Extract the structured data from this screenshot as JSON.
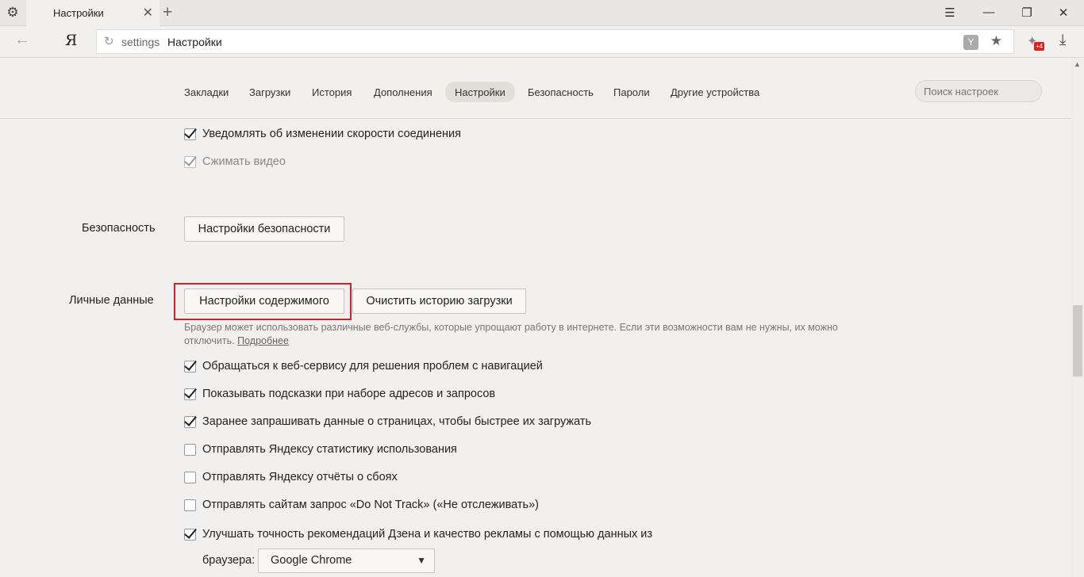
{
  "browser": {
    "tab_title": "Настройки",
    "tab_close": "✕",
    "new_tab": "+",
    "win_menu": "☰",
    "win_minimize": "—",
    "win_restore": "❐",
    "win_close": "✕",
    "logo": "Я",
    "url_prefix": "settings",
    "url_title": "Настройки",
    "notification_badge": "+4"
  },
  "settings_nav": {
    "items": [
      "Закладки",
      "Загрузки",
      "История",
      "Дополнения",
      "Настройки",
      "Безопасность",
      "Пароли",
      "Другие устройства"
    ],
    "active": "Настройки",
    "search_placeholder": "Поиск настроек"
  },
  "top_checks": [
    {
      "label": "Уведомлять об изменении скорости соединения",
      "checked": true,
      "disabled": false
    },
    {
      "label": "Сжимать видео",
      "checked": true,
      "disabled": true
    }
  ],
  "security": {
    "label": "Безопасность",
    "button": "Настройки безопасности"
  },
  "personal": {
    "label": "Личные данные",
    "content_button": "Настройки содержимого",
    "clear_button": "Очистить историю загрузки",
    "description": "Браузер может использовать различные веб-службы, которые упрощают работу в интернете. Если эти возможности вам не нужны, их можно отключить.",
    "more_link": "Подробнее",
    "checks": [
      {
        "label": "Обращаться к веб-сервису для решения проблем с навигацией",
        "checked": true
      },
      {
        "label": "Показывать подсказки при наборе адресов и запросов",
        "checked": true
      },
      {
        "label": "Заранее запрашивать данные о страницах, чтобы быстрее их загружать",
        "checked": true
      },
      {
        "label": "Отправлять Яндексу статистику использования",
        "checked": false
      },
      {
        "label": "Отправлять Яндексу отчёты о сбоях",
        "checked": false
      },
      {
        "label": "Отправлять сайтам запрос «Do Not Track» («Не отслеживать»)",
        "checked": false
      },
      {
        "label": "Улучшать точность рекомендаций Дзена и качество рекламы с помощью данных из",
        "checked": true
      }
    ],
    "browser_label": "браузера:",
    "browser_select": "Google Chrome"
  },
  "colors": {
    "highlight": "#d3202a",
    "background": "#f2f0ee"
  }
}
